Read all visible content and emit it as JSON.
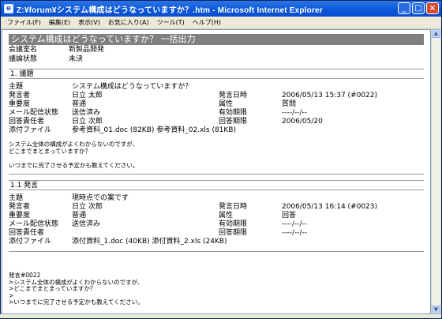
{
  "window": {
    "title": "Z:¥forum¥システム構成はどうなっていますか？.htm - Microsoft Internet Explorer"
  },
  "menu": [
    "ファイル(F)",
    "編集(E)",
    "表示(V)",
    "お気に入り(A)",
    "ツール(T)",
    "ヘルプ(H)"
  ],
  "header": {
    "title": "システム構成はどうなっていますか？ 一括出力",
    "meeting_label": "会議室名",
    "meeting_value": "新製品開発",
    "status_label": "議論状態",
    "status_value": "未決"
  },
  "topic": {
    "section": "1. 議題",
    "rows": [
      [
        "主題",
        "システム構成はどうなっていますか？",
        "",
        ""
      ],
      [
        "発言者",
        "日立 太郎",
        "発言日時",
        "2006/05/13 15:37 (#0022)"
      ],
      [
        "重要度",
        "普通",
        "属性",
        "質問"
      ],
      [
        "メール配信状態",
        "送信済み",
        "有効期限",
        "----/--/--"
      ],
      [
        "回答責任者",
        "日立 次郎",
        "回答期限",
        "2006/05/20"
      ],
      [
        "添付ファイル",
        "参考資料_01.doc (82KB) 参考資料_02.xls (81KB)",
        "",
        ""
      ]
    ],
    "body": [
      "システム全体の構成がよくわからないのですが、",
      "どこまでまとまっていますか？",
      "",
      "いつまでに完了させる予定かも教えてください。"
    ]
  },
  "reply": {
    "section": "1.1 発言",
    "rows": [
      [
        "主題",
        "現時点での案です",
        "",
        ""
      ],
      [
        "発言者",
        "日立 次郎",
        "発言日時",
        "2006/05/13 16:14 (#0023)"
      ],
      [
        "重要度",
        "普通",
        "属性",
        "回答"
      ],
      [
        "メール配信状態",
        "送信済み",
        "有効期限",
        "----/--/--"
      ],
      [
        "回答責任者",
        "",
        "回答期限",
        "----/--/--"
      ],
      [
        "添付ファイル",
        "添付資料_1.doc (40KB) 添付資料_2.xls (24KB)",
        "",
        ""
      ]
    ],
    "quote": [
      "発言#0022",
      ">システム全体の構成がよくわからないのですが、",
      ">どこまでまとまっていますか？",
      ">",
      ">いつまでに完了させる予定かも教えてください。"
    ]
  }
}
